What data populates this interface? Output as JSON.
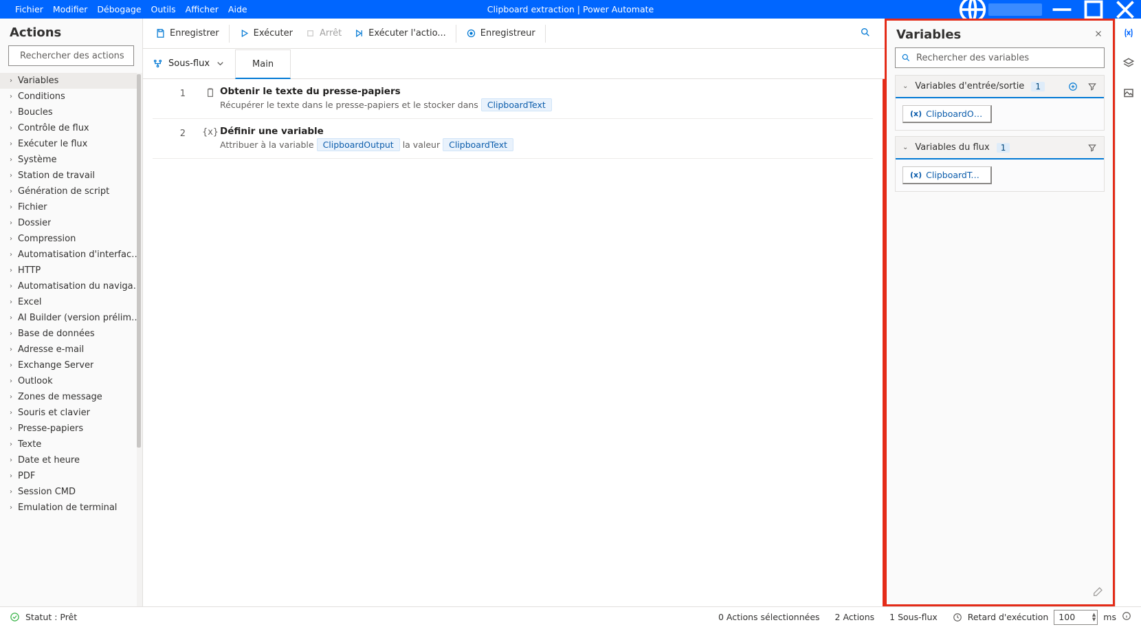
{
  "window": {
    "title": "Clipboard extraction | Power Automate"
  },
  "menu": [
    "Fichier",
    "Modifier",
    "Débogage",
    "Outils",
    "Afficher",
    "Aide"
  ],
  "actions_panel": {
    "title": "Actions",
    "search_placeholder": "Rechercher des actions",
    "categories": [
      "Variables",
      "Conditions",
      "Boucles",
      "Contrôle de flux",
      "Exécuter le flux",
      "Système",
      "Station de travail",
      "Génération de script",
      "Fichier",
      "Dossier",
      "Compression",
      "Automatisation d'interface utilisateur",
      "HTTP",
      "Automatisation du navigateur",
      "Excel",
      "AI Builder (version préliminaire)",
      "Base de données",
      "Adresse e-mail",
      "Exchange Server",
      "Outlook",
      "Zones de message",
      "Souris et clavier",
      "Presse-papiers",
      "Texte",
      "Date et heure",
      "PDF",
      "Session CMD",
      "Émulation de terminal"
    ],
    "selected_index": 0
  },
  "toolbar": {
    "save": "Enregistrer",
    "run": "Exécuter",
    "stop": "Arrêt",
    "run_next": "Exécuter l'actio...",
    "recorder": "Enregistreur"
  },
  "subflow": {
    "button": "Sous-flux",
    "tabs": [
      "Main"
    ],
    "active_tab": 0
  },
  "steps": [
    {
      "num": "1",
      "icon": "clipboard",
      "title": "Obtenir le texte du presse-papiers",
      "desc_prefix": "Récupérer le texte dans le presse-papiers et le stocker dans",
      "chips": [
        "ClipboardText"
      ]
    },
    {
      "num": "2",
      "icon": "variable",
      "title": "Définir une variable",
      "desc_prefix": "Attribuer à la variable",
      "chips": [
        "ClipboardOutput"
      ],
      "desc_middle": "la valeur",
      "chips2": [
        "ClipboardText"
      ]
    }
  ],
  "variables_panel": {
    "title": "Variables",
    "search_placeholder": "Rechercher des variables",
    "sections": [
      {
        "title": "Variables d'entrée/sortie",
        "count": "1",
        "has_add": true,
        "vars": [
          "ClipboardOutp..."
        ]
      },
      {
        "title": "Variables du flux",
        "count": "1",
        "has_add": false,
        "vars": [
          "ClipboardText"
        ]
      }
    ]
  },
  "status": {
    "ready": "Statut : Prêt",
    "selected": "0 Actions sélectionnées",
    "actions": "2 Actions",
    "subflows": "1 Sous-flux",
    "delay_label": "Retard d'exécution",
    "delay_value": "100",
    "delay_unit": "ms"
  }
}
